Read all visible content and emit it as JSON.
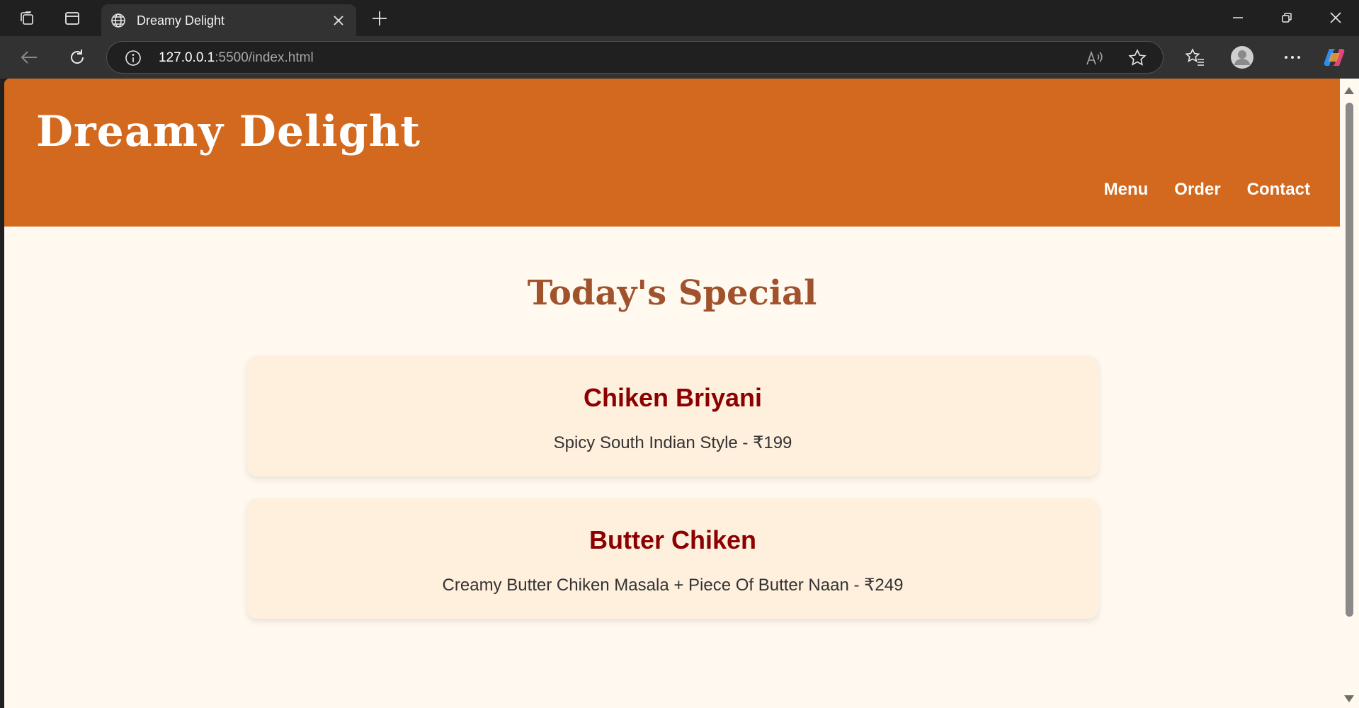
{
  "browser": {
    "tab": {
      "title": "Dreamy Delight"
    },
    "address": {
      "host": "127.0.0.1",
      "path": ":5500/index.html"
    }
  },
  "site": {
    "brand": "Dreamy Delight",
    "nav": {
      "menu": "Menu",
      "order": "Order",
      "contact": "Contact"
    }
  },
  "special": {
    "title": "Today's Special",
    "items": [
      {
        "name": "Chiken Briyani",
        "desc": "Spicy South Indian Style - ₹199"
      },
      {
        "name": "Butter Chiken",
        "desc": "Creamy Butter Chiken Masala + Piece Of Butter Naan - ₹249"
      }
    ]
  },
  "colors": {
    "header": "#d2691e",
    "page_bg": "#fff9ef",
    "card_bg": "#ffefdd",
    "section_title": "#a0522d",
    "card_title": "#8b0000"
  }
}
